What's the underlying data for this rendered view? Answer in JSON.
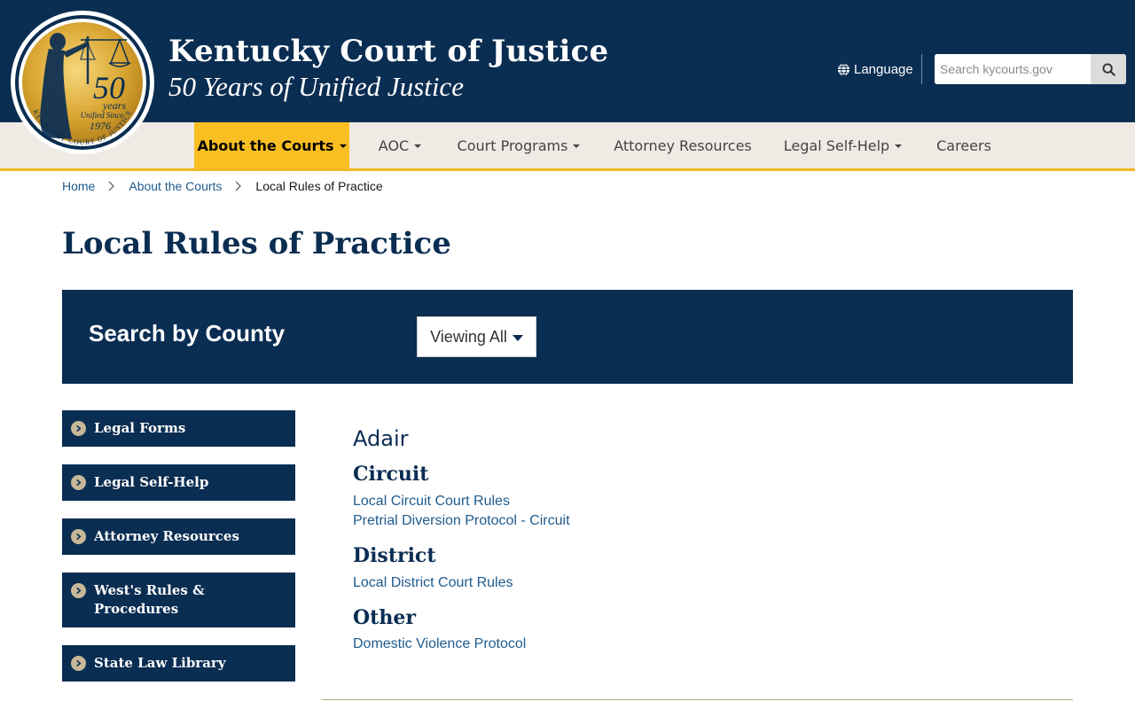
{
  "header": {
    "title": "Kentucky Court of Justice",
    "subtitle": "50 Years of Unified Justice",
    "seal": {
      "number": "50",
      "word": "years",
      "since": "Unified Since",
      "year": "1976",
      "ring_text": "KENTUCKY COURT OF JUSTICE"
    },
    "language_label": "Language",
    "search_placeholder": "Search kycourts.gov"
  },
  "nav": {
    "items": [
      {
        "label": "About the Courts",
        "dropdown": true,
        "active": true
      },
      {
        "label": "AOC",
        "dropdown": true
      },
      {
        "label": "Court Programs",
        "dropdown": true
      },
      {
        "label": "Attorney Resources",
        "dropdown": false
      },
      {
        "label": "Legal Self-Help",
        "dropdown": true
      },
      {
        "label": "Careers",
        "dropdown": false
      }
    ]
  },
  "breadcrumb": {
    "home": "Home",
    "section": "About the Courts",
    "current": "Local Rules of Practice"
  },
  "page_title": "Local Rules of Practice",
  "county_search": {
    "label": "Search by County",
    "selected": "Viewing All"
  },
  "sidebar": {
    "items": [
      "Legal Forms",
      "Legal Self-Help",
      "Attorney Resources",
      "West's Rules & Procedures",
      "State Law Library"
    ]
  },
  "content": {
    "county": "Adair",
    "circuit": {
      "heading": "Circuit",
      "links": [
        "Local Circuit Court Rules",
        "Pretrial Diversion Protocol - Circuit"
      ]
    },
    "district": {
      "heading": "District",
      "links": [
        "Local District Court Rules"
      ]
    },
    "other": {
      "heading": "Other",
      "links": [
        "Domestic Violence Protocol"
      ]
    }
  },
  "colors": {
    "navy": "#0a2d52",
    "gold": "#f9bf22",
    "nav_bg": "#efebe4",
    "link": "#1f5b8f"
  }
}
